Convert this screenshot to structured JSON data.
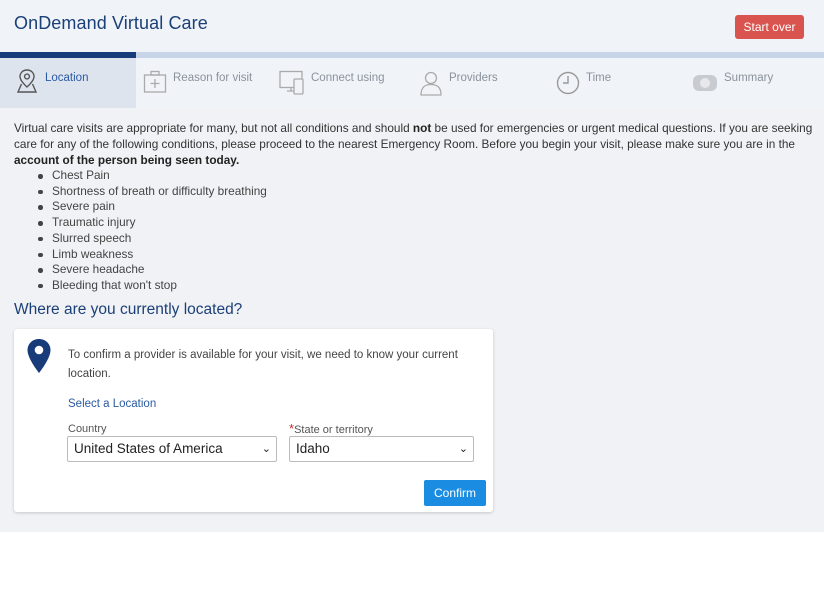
{
  "header": {
    "title": "OnDemand Virtual Care",
    "start_over_label": "Start over",
    "start_over_color": "#d9534f"
  },
  "steps": [
    {
      "label": "Location",
      "icon": "map-pin-icon",
      "active": true
    },
    {
      "label": "Reason for visit",
      "icon": "medical-kit-icon",
      "active": false
    },
    {
      "label": "Connect using",
      "icon": "devices-icon",
      "active": false
    },
    {
      "label": "Providers",
      "icon": "person-icon",
      "active": false
    },
    {
      "label": "Time",
      "icon": "clock-icon",
      "active": false
    },
    {
      "label": "Summary",
      "icon": "summary-icon",
      "active": false
    }
  ],
  "intro": {
    "part1": "Virtual care visits are appropriate for many, but not all conditions and should ",
    "bold1": "not",
    "part2": " be used for emergencies or urgent medical questions. If you are seeking care for any of the following conditions, please proceed to the nearest Emergency Room. Before you begin your visit, please make sure you are in the ",
    "bold2": "account of the person being seen today."
  },
  "conditions": [
    "Chest Pain",
    "Shortness of breath or difficulty breathing",
    "Severe pain",
    "Traumatic injury",
    "Slurred speech",
    "Limb weakness",
    "Severe headache",
    "Bleeding that won't stop"
  ],
  "location": {
    "heading": "Where are you currently located?",
    "description": "To confirm a provider is available for your visit, we need to know your current location.",
    "select_link": "Select a Location",
    "country_label": "Country",
    "country_value": "United States of America",
    "state_required_mark": "*",
    "state_label": "State or territory",
    "state_value": "Idaho",
    "confirm_label": "Confirm"
  },
  "colors": {
    "brand": "#1b3f77",
    "active_step": "#183b79",
    "confirm": "#1a8de2"
  }
}
